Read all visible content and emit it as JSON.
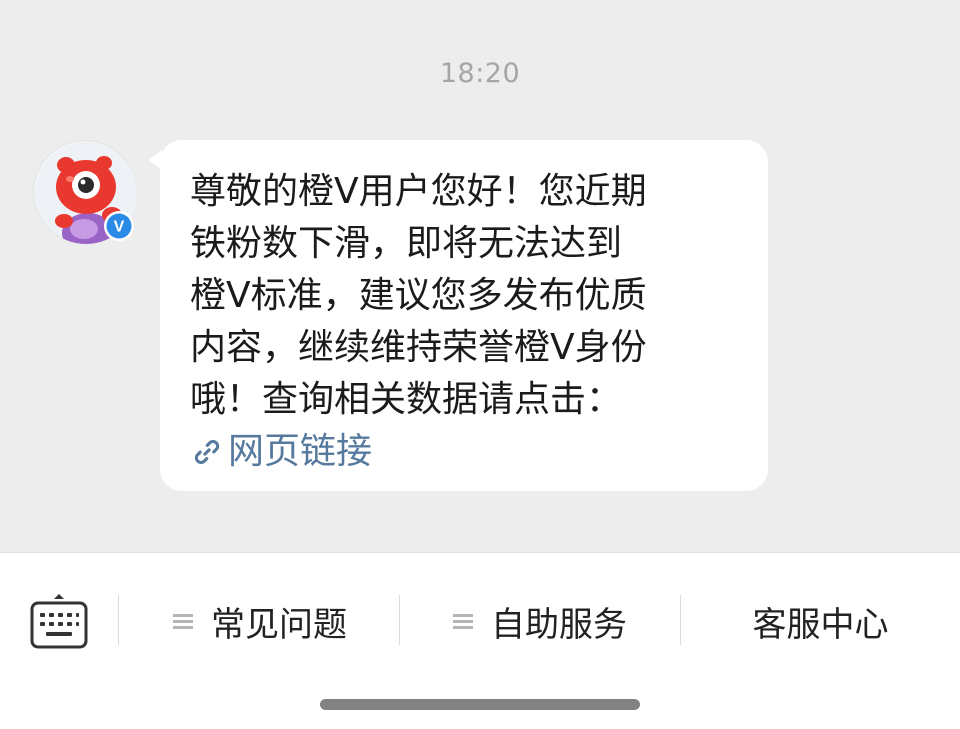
{
  "chat": {
    "timestamp": "18:20",
    "message": {
      "lines": [
        "尊敬的橙V用户您好！您近期",
        "铁粉数下滑，即将无法达到",
        "橙V标准，建议您多发布优质",
        "内容，继续维持荣誉橙V身份",
        "哦！查询相关数据请点击："
      ],
      "link_label": "网页链接",
      "link_icon": "link-icon"
    },
    "sender": {
      "avatar_icon": "mascot-avatar",
      "badge_icon": "verified-v-icon",
      "badge_text": "V"
    }
  },
  "bottom_bar": {
    "keyboard_icon": "keyboard-icon",
    "items": [
      {
        "label": "常见问题",
        "has_menu_icon": true
      },
      {
        "label": "自助服务",
        "has_menu_icon": true
      },
      {
        "label": "客服中心",
        "has_menu_icon": false
      }
    ]
  },
  "colors": {
    "background": "#ededed",
    "bubble": "#ffffff",
    "link": "#56799e",
    "badge": "#2a8be6",
    "mascot_red": "#e8382f"
  }
}
